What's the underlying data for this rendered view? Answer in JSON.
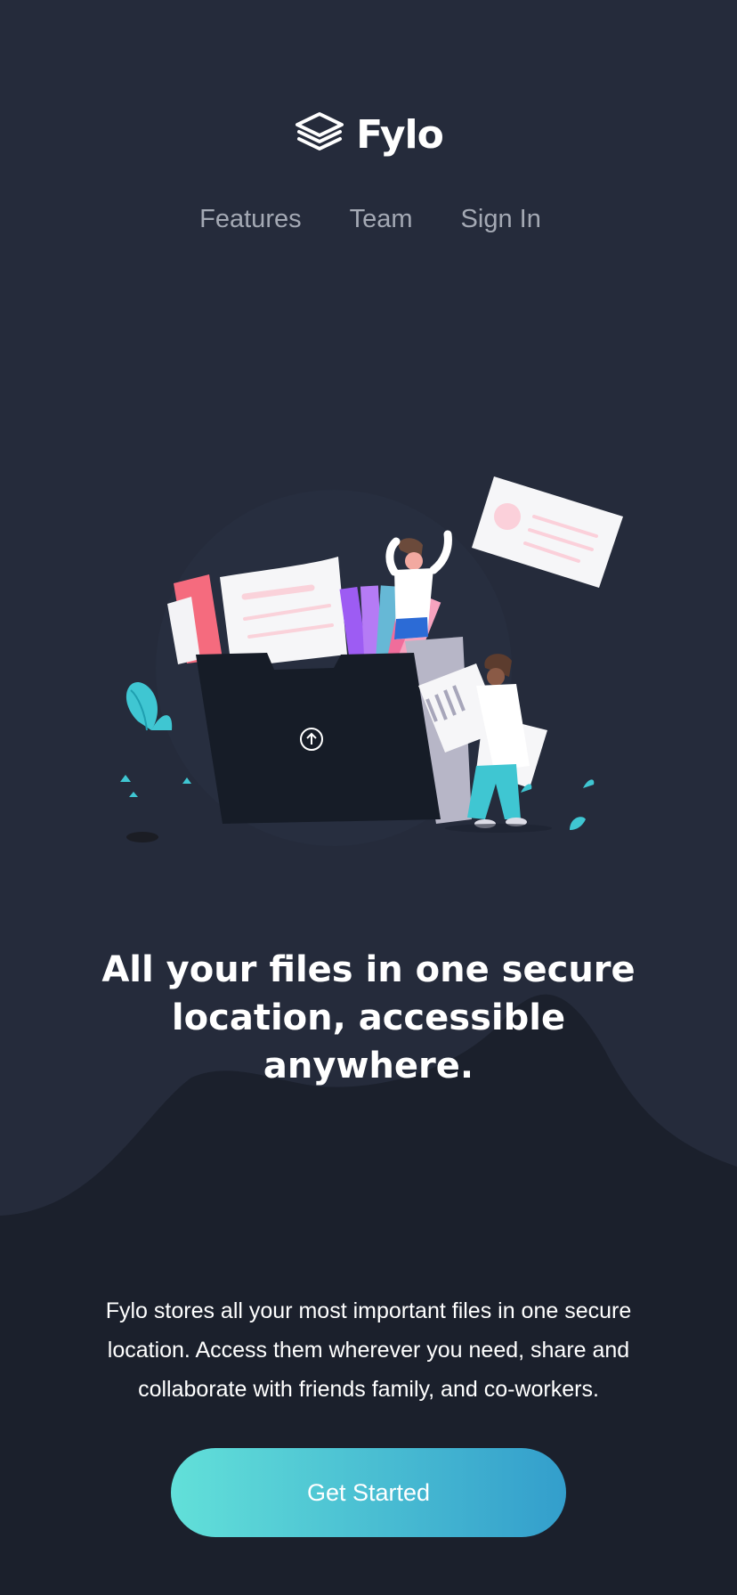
{
  "brand": {
    "name": "Fylo",
    "logo_icon": "layers-icon"
  },
  "nav": {
    "items": [
      {
        "label": "Features"
      },
      {
        "label": "Team"
      },
      {
        "label": "Sign In"
      }
    ]
  },
  "hero": {
    "illustration": "intro-illustration",
    "headline": "All your files in one secure location, accessible anywhere.",
    "description": "Fylo stores all your most important files in one secure location. Access them wherever you need, share and collaborate with friends family, and co-workers.",
    "cta_label": "Get Started"
  },
  "colors": {
    "background_top": "#252b3b",
    "background_bottom": "#1c2230",
    "cta_gradient_start": "#62e0d9",
    "cta_gradient_end": "#339ecc",
    "nav_text": "#a4a9b4"
  }
}
